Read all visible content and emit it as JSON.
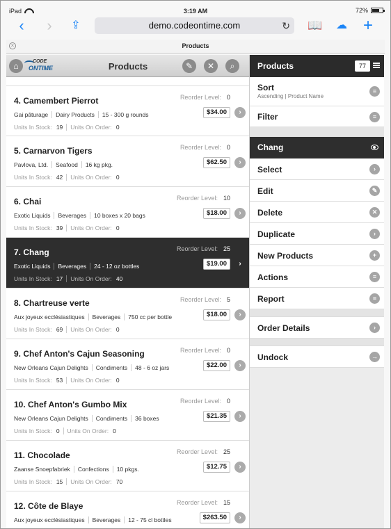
{
  "status_bar": {
    "device": "iPad",
    "time": "3:19 AM",
    "battery": "72%",
    "battery_level": 0.72
  },
  "browser": {
    "url": "demo.codeontime.com",
    "tab_title": "Products"
  },
  "app": {
    "title": "Products",
    "logo_line1": "CODE",
    "logo_line2": "ONTIME"
  },
  "labels": {
    "reorder": "Reorder Level:",
    "stock": "Units In Stock:",
    "order": "Units On Order:"
  },
  "products": [
    {
      "title": "4. Camembert Pierrot",
      "reorder": "0",
      "supplier": "Gai pâturage",
      "category": "Dairy Products",
      "qty": "15 - 300 g rounds",
      "price": "$34.00",
      "stock": "19",
      "order": "0"
    },
    {
      "title": "5. Carnarvon Tigers",
      "reorder": "0",
      "supplier": "Pavlova, Ltd.",
      "category": "Seafood",
      "qty": "16 kg pkg.",
      "price": "$62.50",
      "stock": "42",
      "order": "0"
    },
    {
      "title": "6. Chai",
      "reorder": "10",
      "supplier": "Exotic Liquids",
      "category": "Beverages",
      "qty": "10 boxes x 20 bags",
      "price": "$18.00",
      "stock": "39",
      "order": "0"
    },
    {
      "title": "7. Chang",
      "reorder": "25",
      "supplier": "Exotic Liquids",
      "category": "Beverages",
      "qty": "24 - 12 oz bottles",
      "price": "$19.00",
      "stock": "17",
      "order": "40",
      "selected": true
    },
    {
      "title": "8. Chartreuse verte",
      "reorder": "5",
      "supplier": "Aux joyeux ecclésiastiques",
      "category": "Beverages",
      "qty": "750 cc per bottle",
      "price": "$18.00",
      "stock": "69",
      "order": "0"
    },
    {
      "title": "9. Chef Anton's Cajun Seasoning",
      "reorder": "0",
      "supplier": "New Orleans Cajun Delights",
      "category": "Condiments",
      "qty": "48 - 6 oz jars",
      "price": "$22.00",
      "stock": "53",
      "order": "0"
    },
    {
      "title": "10. Chef Anton's Gumbo Mix",
      "reorder": "0",
      "supplier": "New Orleans Cajun Delights",
      "category": "Condiments",
      "qty": "36 boxes",
      "price": "$21.35",
      "stock": "0",
      "order": "0"
    },
    {
      "title": "11. Chocolade",
      "reorder": "25",
      "supplier": "Zaanse Snoepfabriek",
      "category": "Confections",
      "qty": "10 pkgs.",
      "price": "$12.75",
      "stock": "15",
      "order": "70"
    },
    {
      "title": "12. Côte de Blaye",
      "reorder": "15",
      "supplier": "Aux joyeux ecclésiastiques",
      "category": "Beverages",
      "qty": "12 - 75 cl bottles",
      "price": "$263.50",
      "stock": "",
      "order": ""
    }
  ],
  "panel": {
    "title": "Products",
    "count": "77",
    "sort_label": "Sort",
    "sort_sub": "Ascending | Product Name",
    "filter_label": "Filter",
    "selected_label": "Chang",
    "actions": [
      "Select",
      "Edit",
      "Delete",
      "Duplicate",
      "New Products",
      "Actions",
      "Report"
    ],
    "action_icons": [
      "chevron-right-icon",
      "pencil-icon",
      "close-icon",
      "chevron-right-icon",
      "plus-icon",
      "menu-icon",
      "menu-icon"
    ],
    "order_details": "Order Details",
    "undock": "Undock"
  }
}
